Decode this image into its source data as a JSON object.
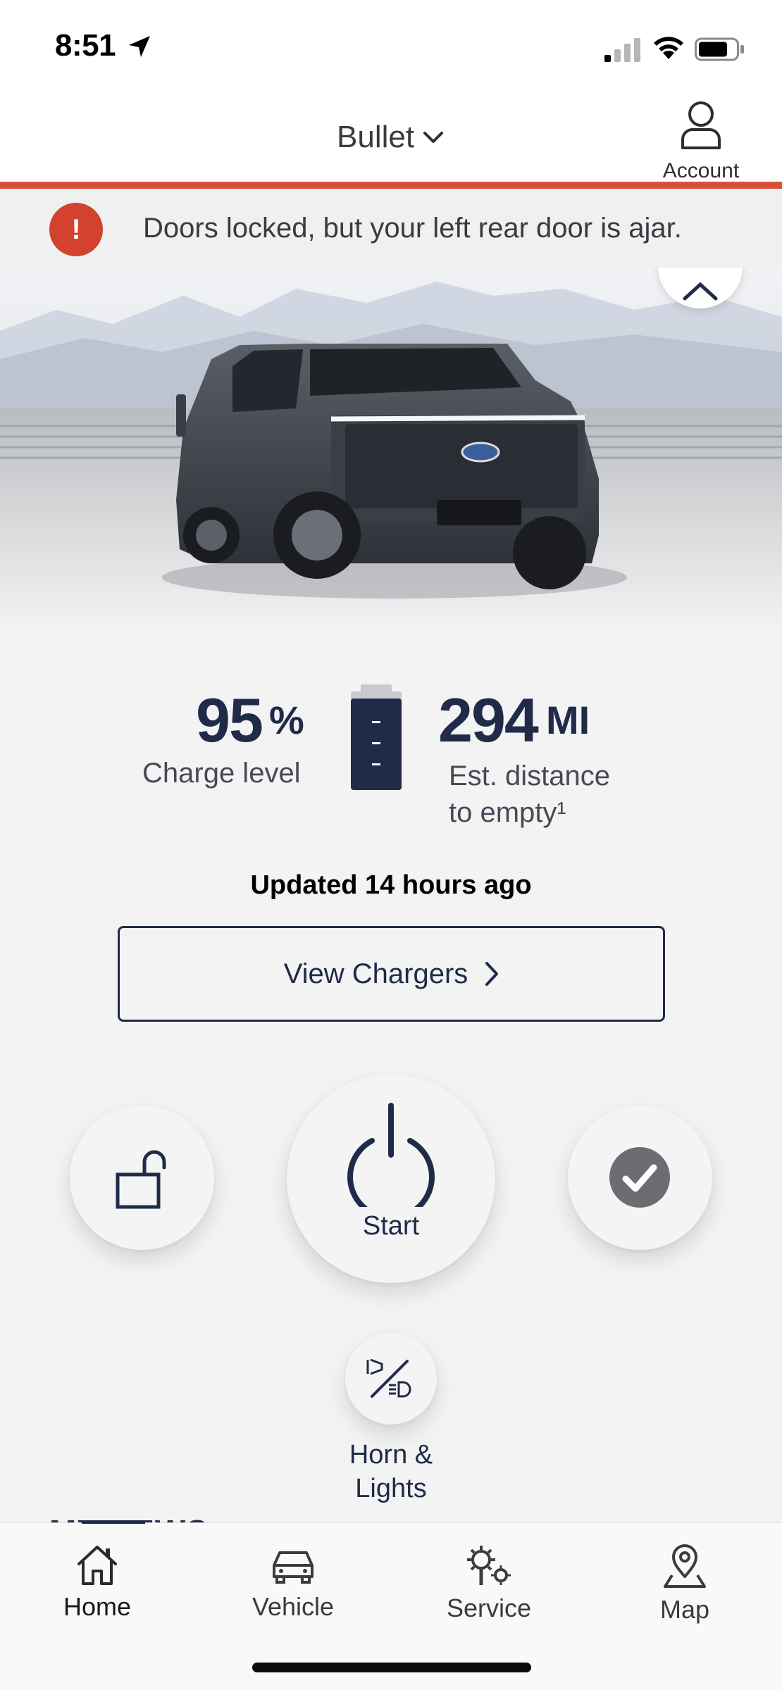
{
  "status_bar": {
    "time": "8:51",
    "icons": [
      "location-arrow-icon",
      "cellular-signal-icon",
      "wifi-icon",
      "battery-icon"
    ]
  },
  "header": {
    "vehicle_name": "Bullet",
    "account_label": "Account",
    "accent_color": "#d9503a"
  },
  "alert": {
    "icon": "!",
    "message": "Doors locked, but your left rear door is ajar.",
    "icon_color": "#d3422e"
  },
  "vehicle_status": {
    "charge_value": "95",
    "charge_unit": "%",
    "charge_label": "Charge level",
    "range_value": "294",
    "range_unit": "MI",
    "range_label_line1": "Est. distance",
    "range_label_line2": "to empty¹",
    "updated": "Updated 14 hours ago"
  },
  "chargers": {
    "label": "View Chargers"
  },
  "controls": {
    "start_label": "Start",
    "horn_label_line1": "Horn &",
    "horn_label_line2": "Lights",
    "brand_color": "#1f2b48"
  },
  "news": {
    "heading_peek": "MY NEWS"
  },
  "tab_bar": {
    "tabs": [
      {
        "label": "Home",
        "icon": "home-icon",
        "active": true
      },
      {
        "label": "Vehicle",
        "icon": "car-icon",
        "active": false
      },
      {
        "label": "Service",
        "icon": "service-gears-icon",
        "active": false
      },
      {
        "label": "Map",
        "icon": "map-pin-icon",
        "active": false
      }
    ]
  }
}
